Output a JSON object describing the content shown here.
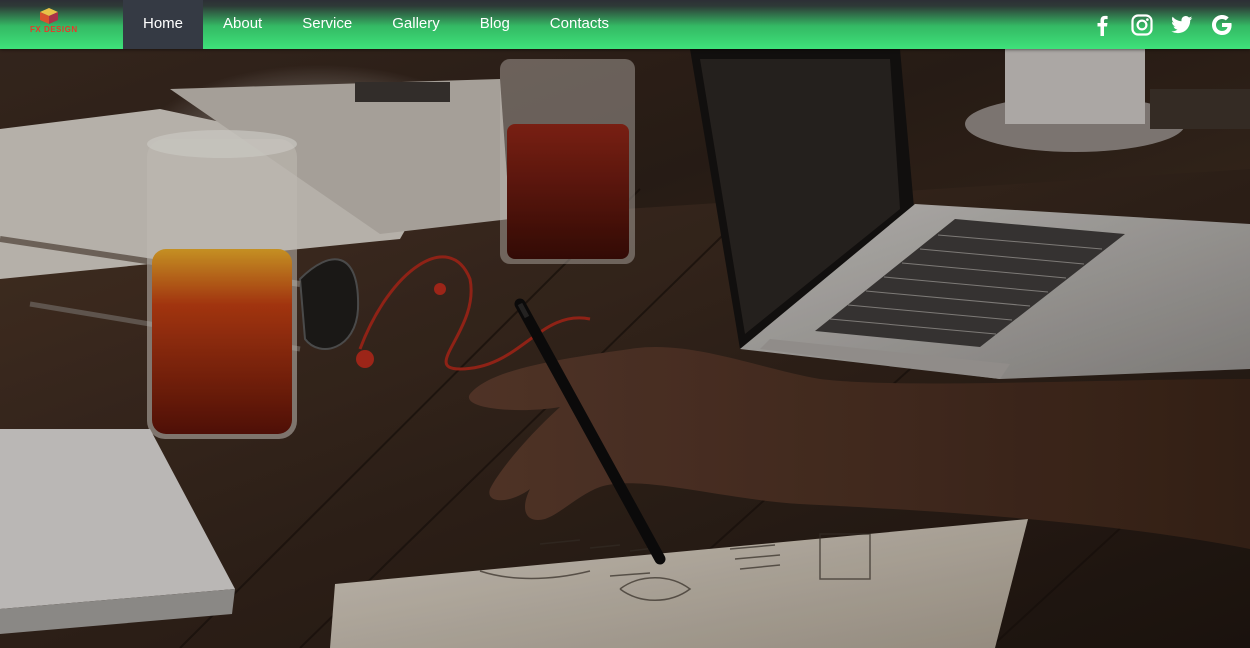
{
  "brand": {
    "logo_text": "FX DESIGN",
    "accent_color": "#e8382a"
  },
  "nav": {
    "items": [
      {
        "label": "Home",
        "active": true
      },
      {
        "label": "About",
        "active": false
      },
      {
        "label": "Service",
        "active": false
      },
      {
        "label": "Gallery",
        "active": false
      },
      {
        "label": "Blog",
        "active": false
      },
      {
        "label": "Contacts",
        "active": false
      }
    ],
    "social": [
      "facebook-icon",
      "instagram-icon",
      "twitter-icon",
      "google-icon"
    ]
  },
  "colors": {
    "nav_gradient_top": "#2d2f36",
    "nav_gradient_bottom": "#3ee27a",
    "nav_active_bg": "#353a44"
  },
  "hero": {
    "image_description": "workspace photo"
  }
}
